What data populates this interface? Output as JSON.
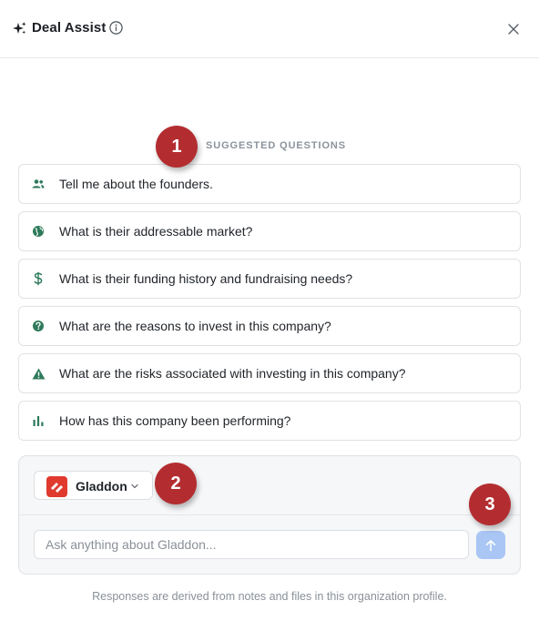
{
  "header": {
    "title": "Deal Assist",
    "close_label": "×"
  },
  "suggested": {
    "label": "SUGGESTED QUESTIONS",
    "questions": [
      {
        "icon": "people-icon",
        "text": "Tell me about the founders."
      },
      {
        "icon": "globe-icon",
        "text": "What is their addressable market?"
      },
      {
        "icon": "dollar-icon",
        "text": "What is their funding history and fundraising needs?"
      },
      {
        "icon": "question-circle-icon",
        "text": "What are the reasons to invest in this company?"
      },
      {
        "icon": "warning-triangle-icon",
        "text": "What are the risks associated with investing in this company?"
      },
      {
        "icon": "bar-chart-icon",
        "text": "How has this company been performing?"
      }
    ]
  },
  "compose": {
    "org_name": "Gladdon",
    "input_placeholder": "Ask anything about Gladdon...",
    "input_value": ""
  },
  "footer": {
    "note": "Responses are derived from notes and files in this organization profile."
  },
  "annotations": [
    "1",
    "2",
    "3"
  ],
  "colors": {
    "icon_green": "#2f7a5b",
    "send_button": "#a9c6f5",
    "badge_red": "#b32d30",
    "org_logo_red": "#e03a2f"
  }
}
